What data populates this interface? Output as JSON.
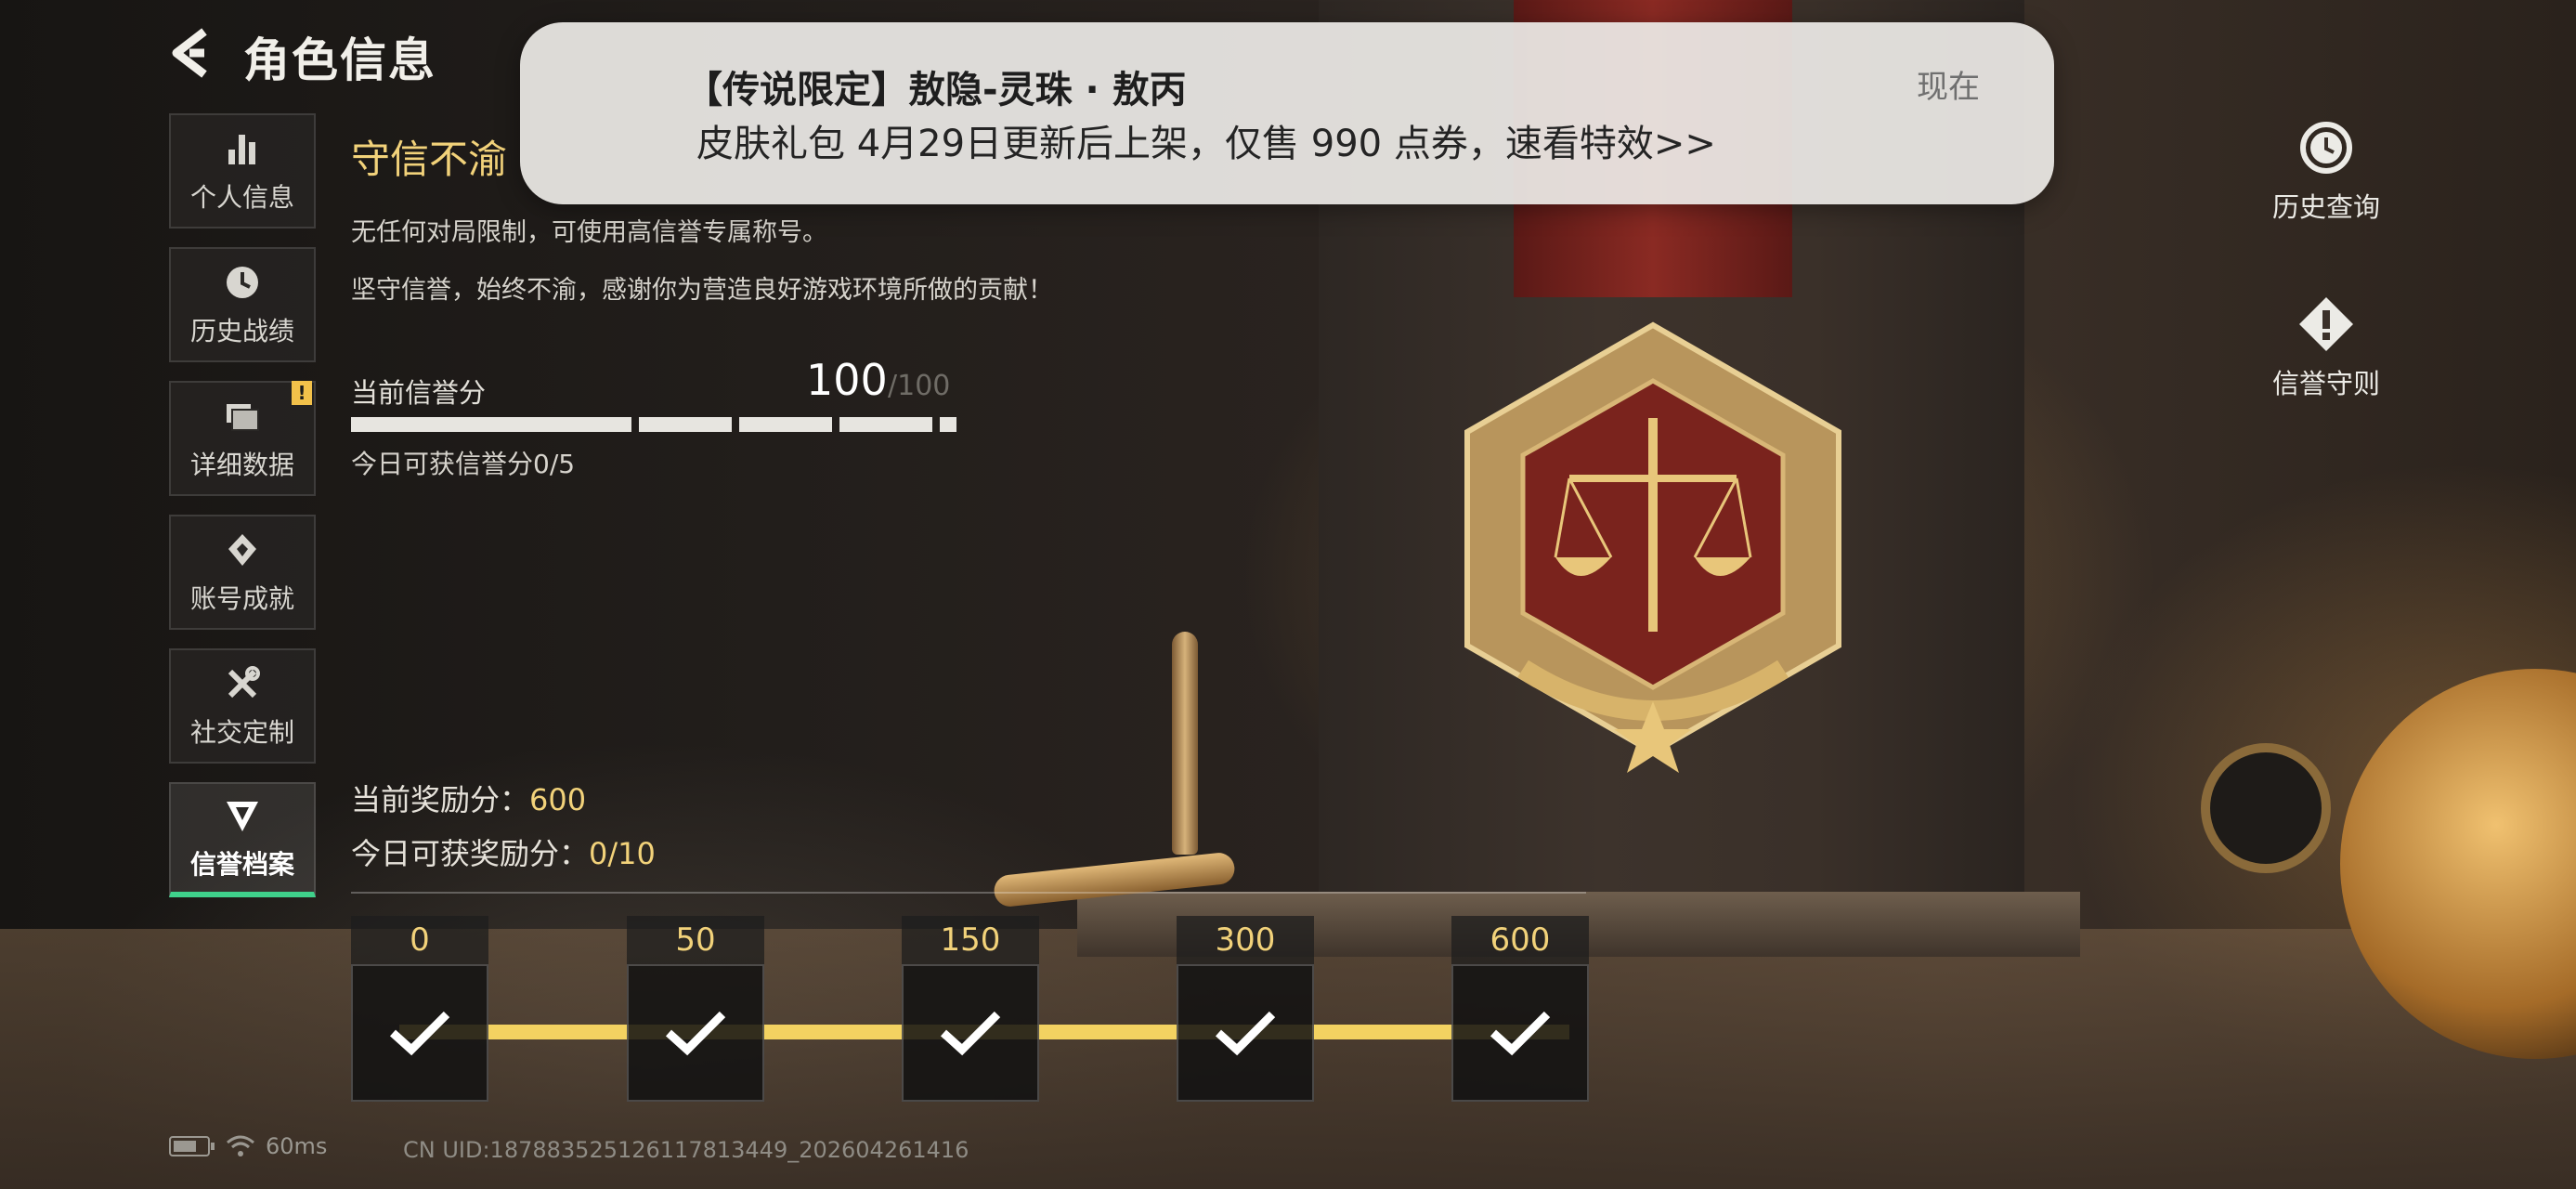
{
  "header": {
    "title": "角色信息"
  },
  "sidebar": {
    "items": [
      {
        "label": "个人信息",
        "icon": "bar-chart-icon",
        "badge": ""
      },
      {
        "label": "历史战绩",
        "icon": "history-clock-icon",
        "badge": ""
      },
      {
        "label": "详细数据",
        "icon": "folder-icon",
        "badge": "!"
      },
      {
        "label": "账号成就",
        "icon": "achievement-icon",
        "badge": ""
      },
      {
        "label": "社交定制",
        "icon": "tools-icon",
        "badge": ""
      },
      {
        "label": "信誉档案",
        "icon": "reputation-shield-icon",
        "badge": "",
        "active": true
      }
    ]
  },
  "reputation": {
    "title": "守信不渝",
    "desc1": "无任何对局限制，可使用高信誉专属称号。",
    "desc2": "坚守信誉，始终不渝，感谢你为营造良好游戏环境所做的贡献！",
    "score_label": "当前信誉分",
    "score": "100",
    "score_max": "/100",
    "score_fraction": 1.0,
    "today_gain": "今日可获信誉分0/5"
  },
  "rewards": {
    "current_label": "当前奖励分：",
    "current_value": "600",
    "today_label": "今日可获奖励分：",
    "today_value": "0/10",
    "milestones": [
      {
        "value": "0",
        "claimed": true
      },
      {
        "value": "50",
        "claimed": true
      },
      {
        "value": "150",
        "claimed": true
      },
      {
        "value": "300",
        "claimed": true
      },
      {
        "value": "600",
        "claimed": true
      }
    ]
  },
  "right_rail": {
    "history": {
      "label": "历史查询",
      "icon": "history-icon"
    },
    "rules": {
      "label": "信誉守则",
      "icon": "warning-diamond-icon"
    }
  },
  "notification": {
    "title": "【传说限定】敖隐-灵珠 · 敖丙",
    "body": "皮肤礼包 4月29日更新后上架，仅售 990 点券，速看特效>>",
    "time": "现在"
  },
  "status_bar": {
    "ping": "60ms",
    "uid": "CN UID:18788352512611781344​9_202604261416",
    "battery_level": 0.6
  },
  "colors": {
    "accent_gold": "#f2d27a",
    "active_tab": "#3fd18b",
    "track": "#f3d261"
  }
}
